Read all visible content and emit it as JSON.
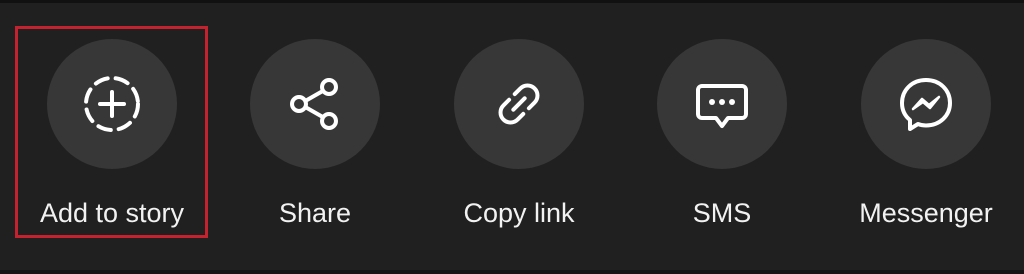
{
  "share_sheet": {
    "options": [
      {
        "label": "Add to story",
        "icon": "add-story-icon"
      },
      {
        "label": "Share",
        "icon": "share-icon"
      },
      {
        "label": "Copy link",
        "icon": "link-icon"
      },
      {
        "label": "SMS",
        "icon": "sms-icon"
      },
      {
        "label": "Messenger",
        "icon": "messenger-icon"
      }
    ],
    "highlighted_option": "Add to story"
  },
  "colors": {
    "background": "#202020",
    "icon_circle": "#373737",
    "icon": "#ffffff",
    "label_text": "#f2f2f2",
    "highlight_border": "#c4222f"
  }
}
